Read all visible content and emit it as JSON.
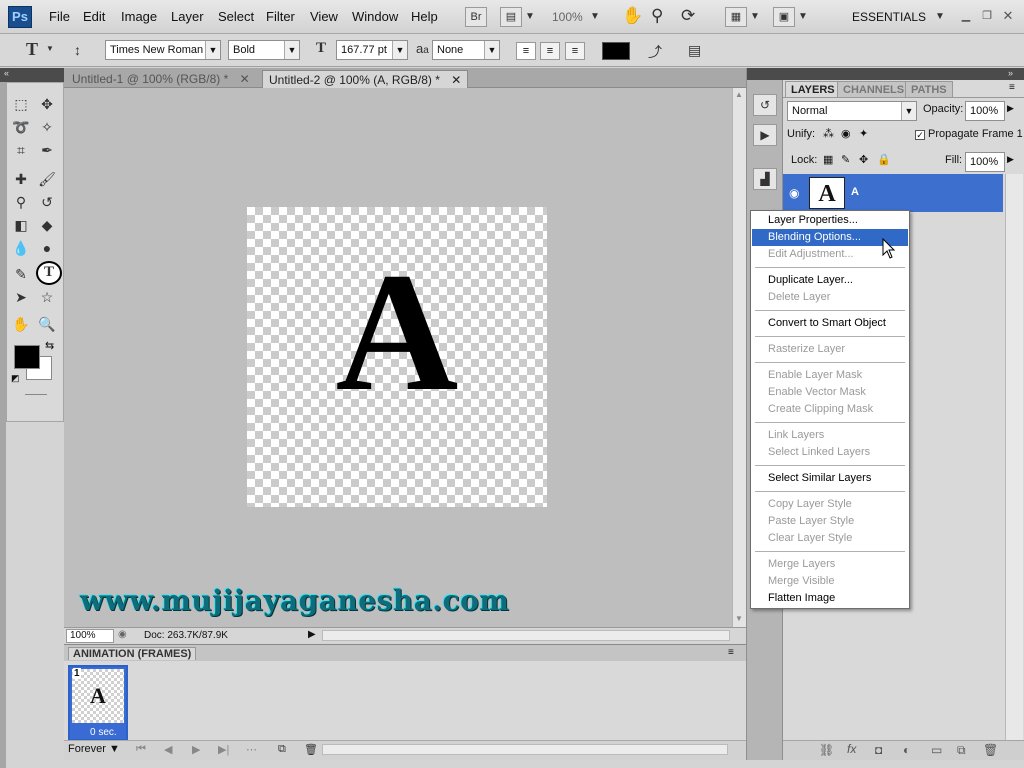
{
  "app": {
    "logo": "Ps",
    "workspace": "ESSENTIALS",
    "zoom": "100%"
  },
  "menubar": {
    "items": [
      "File",
      "Edit",
      "Image",
      "Layer",
      "Select",
      "Filter",
      "View",
      "Window",
      "Help"
    ],
    "bridge_label": "Br"
  },
  "options": {
    "tool_glyph": "T",
    "font_family": "Times New Roman",
    "font_style": "Bold",
    "font_size": "167.77 pt",
    "aa_label": "a",
    "anti_alias": "None"
  },
  "document": {
    "tabs": [
      "Untitled-1 @ 100% (RGB/8) *",
      "Untitled-2 @ 100% (A, RGB/8) *"
    ],
    "canvas_text": "A",
    "watermark": "www.mujijayaganesha.com",
    "status_zoom": "100%",
    "status_doc": "Doc: 263.7K/87.9K"
  },
  "animation": {
    "title": "ANIMATION (FRAMES)",
    "frame_number": "1",
    "frame_glyph": "A",
    "frame_delay": "0 sec.",
    "loop": "Forever"
  },
  "layers": {
    "tabs": [
      "LAYERS",
      "CHANNELS",
      "PATHS"
    ],
    "blend_mode": "Normal",
    "opacity_label": "Opacity:",
    "opacity": "100%",
    "unify_label": "Unify:",
    "propagate_label": "Propagate Frame 1",
    "lock_label": "Lock:",
    "fill_label": "Fill:",
    "fill": "100%",
    "layer_name": "A",
    "layer_glyph": "A"
  },
  "context_menu": {
    "items": [
      {
        "label": "Layer Properties...",
        "state": "enabled"
      },
      {
        "label": "Blending Options...",
        "state": "highlight"
      },
      {
        "label": "Edit Adjustment...",
        "state": "disabled"
      },
      {
        "label": "Duplicate Layer...",
        "state": "enabled"
      },
      {
        "label": "Delete Layer",
        "state": "disabled"
      },
      {
        "label": "Convert to Smart Object",
        "state": "enabled"
      },
      {
        "label": "Rasterize Layer",
        "state": "disabled"
      },
      {
        "label": "Enable Layer Mask",
        "state": "disabled"
      },
      {
        "label": "Enable Vector Mask",
        "state": "disabled"
      },
      {
        "label": "Create Clipping Mask",
        "state": "disabled"
      },
      {
        "label": "Link Layers",
        "state": "disabled"
      },
      {
        "label": "Select Linked Layers",
        "state": "disabled"
      },
      {
        "label": "Select Similar Layers",
        "state": "enabled"
      },
      {
        "label": "Copy Layer Style",
        "state": "disabled"
      },
      {
        "label": "Paste Layer Style",
        "state": "disabled"
      },
      {
        "label": "Clear Layer Style",
        "state": "disabled"
      },
      {
        "label": "Merge Layers",
        "state": "disabled"
      },
      {
        "label": "Merge Visible",
        "state": "disabled"
      },
      {
        "label": "Flatten Image",
        "state": "enabled"
      }
    ]
  },
  "colors": {
    "accent": "#3169c6",
    "foreground": "#000000",
    "background": "#ffffff",
    "watermark": "#0e6d7a"
  }
}
